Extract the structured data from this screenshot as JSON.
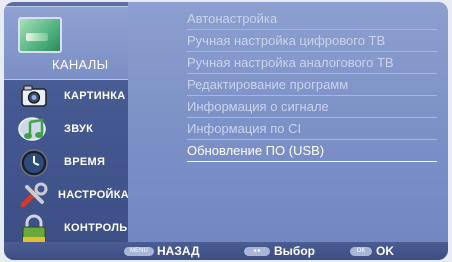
{
  "sidebar": {
    "items": [
      {
        "label": "КАНАЛЫ",
        "icon": "channels-tv-icon",
        "selected": true
      },
      {
        "label": "КАРТИНКА",
        "icon": "camera-icon"
      },
      {
        "label": "ЗВУК",
        "icon": "music-note-icon"
      },
      {
        "label": "ВРЕМЯ",
        "icon": "clock-icon"
      },
      {
        "label": "НАСТРОЙКА",
        "icon": "wrench-icon"
      },
      {
        "label": "КОНТРОЛЬ",
        "icon": "lock-icon"
      }
    ]
  },
  "menu": {
    "items": [
      {
        "label": "Автонастройка"
      },
      {
        "label": "Ручная настройка цифрового ТВ"
      },
      {
        "label": "Ручная настройка аналогового ТВ"
      },
      {
        "label": "Редактирование программ"
      },
      {
        "label": "Информация о сигнале"
      },
      {
        "label": "Информация по CI"
      },
      {
        "label": "Обновление ПО (USB)",
        "active": true
      }
    ]
  },
  "footer": {
    "back_key": "MENU",
    "back_label": "НАЗАД",
    "select_key": "◂ ▸",
    "select_label": "Выбор",
    "ok_key": "OK",
    "ok_label": "OK"
  },
  "colors": {
    "panel": "#7f93c2",
    "sidebar": "#465a92",
    "selected": "#8fa2d2",
    "text_active": "#ffffff",
    "text_inactive": "#c9d3ee"
  }
}
